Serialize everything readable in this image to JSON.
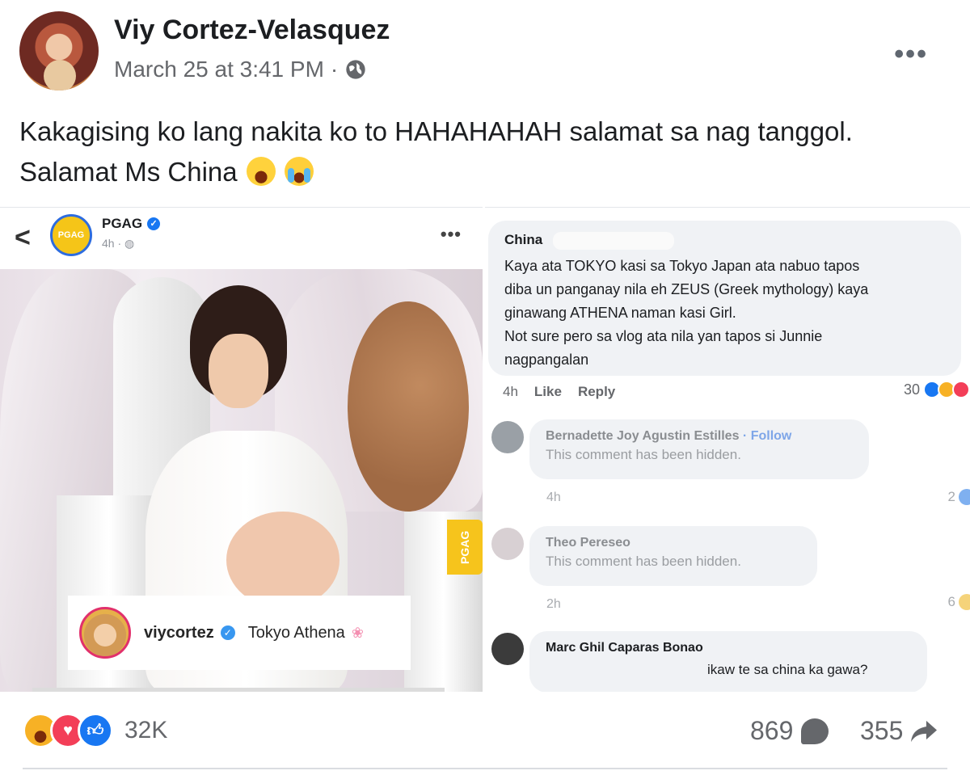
{
  "post": {
    "author": "Viy Cortez-Velasquez",
    "timestamp": "March 25 at 3:41 PM",
    "separator": "·",
    "more_label": "•••",
    "caption_line1": "Kakagising ko lang nakita ko to HAHAHAHAH salamat sa nag tanggol.",
    "caption_line2": "Salamat Ms  China"
  },
  "left_screenshot": {
    "back_label": "<",
    "page_avatar_text": "PGAG",
    "page_name": "PGAG",
    "page_time": "4h · ",
    "more_label": "•••",
    "side_tag": "PGAG",
    "tag_username": "viycortez",
    "tag_caption": "Tokyo Athena",
    "verified_mark": "✓",
    "flower": "❀"
  },
  "comments": {
    "main": {
      "author": "China",
      "lines": [
        "Kaya ata TOKYO kasi sa Tokyo Japan ata nabuo tapos",
        "diba un panganay nila eh ZEUS (Greek mythology) kaya",
        "ginawang ATHENA naman kasi Girl.",
        "Not sure pero sa vlog ata nila yan tapos si Junnie",
        "nagpangalan"
      ],
      "time": "4h",
      "like_label": "Like",
      "reply_label": "Reply",
      "reaction_count": "30"
    },
    "replies": [
      {
        "author": "Bernadette Joy Agustin Estilles",
        "follow": "· Follow",
        "text": "This comment has been hidden.",
        "time": "4h",
        "count": "2"
      },
      {
        "author": "Theo Pereseo",
        "text": "This comment has been hidden.",
        "time": "2h",
        "count": "6"
      },
      {
        "author": "Marc Ghil Caparas Bonao",
        "text": "ikaw te sa china ka gawa?"
      }
    ]
  },
  "footer": {
    "reaction_count": "32K",
    "comment_count": "869",
    "share_count": "355"
  },
  "colors": {
    "like_blue": "#1877f2",
    "love_red": "#f33e58",
    "haha_yellow": "#f7b125",
    "pgag_yellow": "#f6c41c"
  }
}
